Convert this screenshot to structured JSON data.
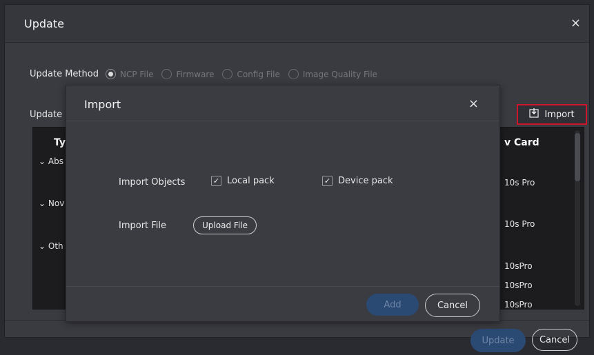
{
  "window": {
    "title": "Update",
    "close_icon": "×"
  },
  "update_method": {
    "label": "Update Method",
    "options": [
      {
        "label": "NCP File",
        "checked": true
      },
      {
        "label": "Firmware",
        "checked": false
      },
      {
        "label": "Config File",
        "checked": false
      },
      {
        "label": "Image Quality File",
        "checked": false
      }
    ]
  },
  "update_label": "Update",
  "import_button": {
    "label": "Import",
    "icon": "import-icon"
  },
  "table": {
    "header_type": "Typ",
    "header_card": "v Card",
    "groups": [
      "Abs",
      "Nov",
      "Oth"
    ],
    "card_values": [
      "10s Pro",
      "10s Pro",
      "10sPro",
      "10sPro",
      "10sPro"
    ]
  },
  "footer": {
    "update_label": "Update",
    "cancel_label": "Cancel"
  },
  "modal": {
    "title": "Import",
    "close_icon": "×",
    "import_objects_label": "Import Objects",
    "local_pack_label": "Local pack",
    "device_pack_label": "Device pack",
    "import_file_label": "Import File",
    "upload_button": "Upload File",
    "add_label": "Add",
    "cancel_label": "Cancel"
  },
  "colors": {
    "accent_red": "#d0142b",
    "disabled_blue": "#2a4a73"
  }
}
